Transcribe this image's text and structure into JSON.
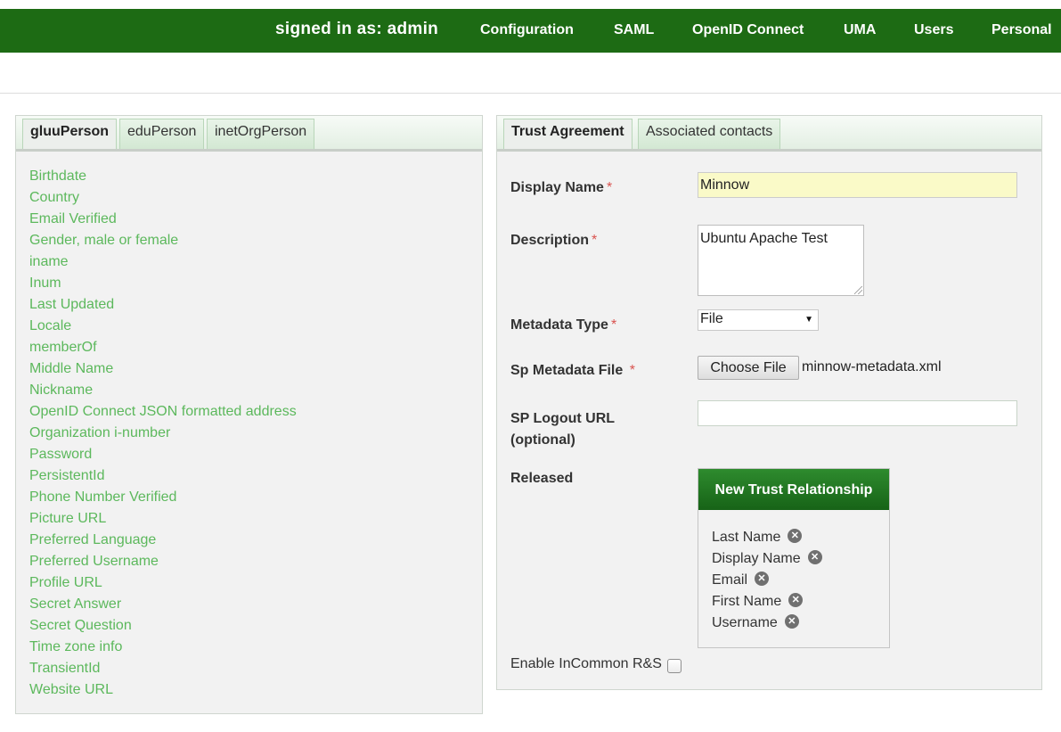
{
  "nav": {
    "signed_in": "signed in as: admin",
    "items": [
      "Configuration",
      "SAML",
      "OpenID Connect",
      "UMA",
      "Users",
      "Personal"
    ]
  },
  "left_panel": {
    "tabs": [
      "gluuPerson",
      "eduPerson",
      "inetOrgPerson"
    ],
    "active_tab": "gluuPerson",
    "attributes": [
      "Birthdate",
      "Country",
      "Email Verified",
      "Gender, male or female",
      "iname",
      "Inum",
      "Last Updated",
      "Locale",
      "memberOf",
      "Middle Name",
      "Nickname",
      "OpenID Connect JSON formatted address",
      "Organization i-number",
      "Password",
      "PersistentId",
      "Phone Number Verified",
      "Picture URL",
      "Preferred Language",
      "Preferred Username",
      "Profile URL",
      "Secret Answer",
      "Secret Question",
      "Time zone info",
      "TransientId",
      "Website URL"
    ]
  },
  "right_panel": {
    "tabs": [
      "Trust Agreement",
      "Associated contacts"
    ],
    "active_tab": "Trust Agreement",
    "form": {
      "display_name_label": "Display Name",
      "display_name_value": "Minnow",
      "description_label": "Description",
      "description_value": "Ubuntu Apache Test",
      "metadata_type_label": "Metadata Type",
      "metadata_type_value": "File",
      "sp_metadata_file_label": "Sp Metadata File",
      "choose_file_label": "Choose File",
      "file_name": "minnow-metadata.xml",
      "sp_logout_url_label_line1": "SP Logout URL",
      "sp_logout_url_label_line2": "(optional)",
      "sp_logout_url_value": "",
      "released_label": "Released",
      "required_mark": "*",
      "enable_incommon_label": "Enable InCommon R&S"
    },
    "trust_relationship": {
      "title": "New Trust Relationship",
      "released_attributes": [
        "Last Name",
        "Display Name",
        "Email",
        "First Name",
        "Username"
      ],
      "remove_glyph": "✕"
    }
  },
  "colors": {
    "nav_bg": "#1d6b14",
    "link_green": "#5cb85c",
    "required_red": "#d9534f",
    "highlight_input": "#fafac8"
  }
}
